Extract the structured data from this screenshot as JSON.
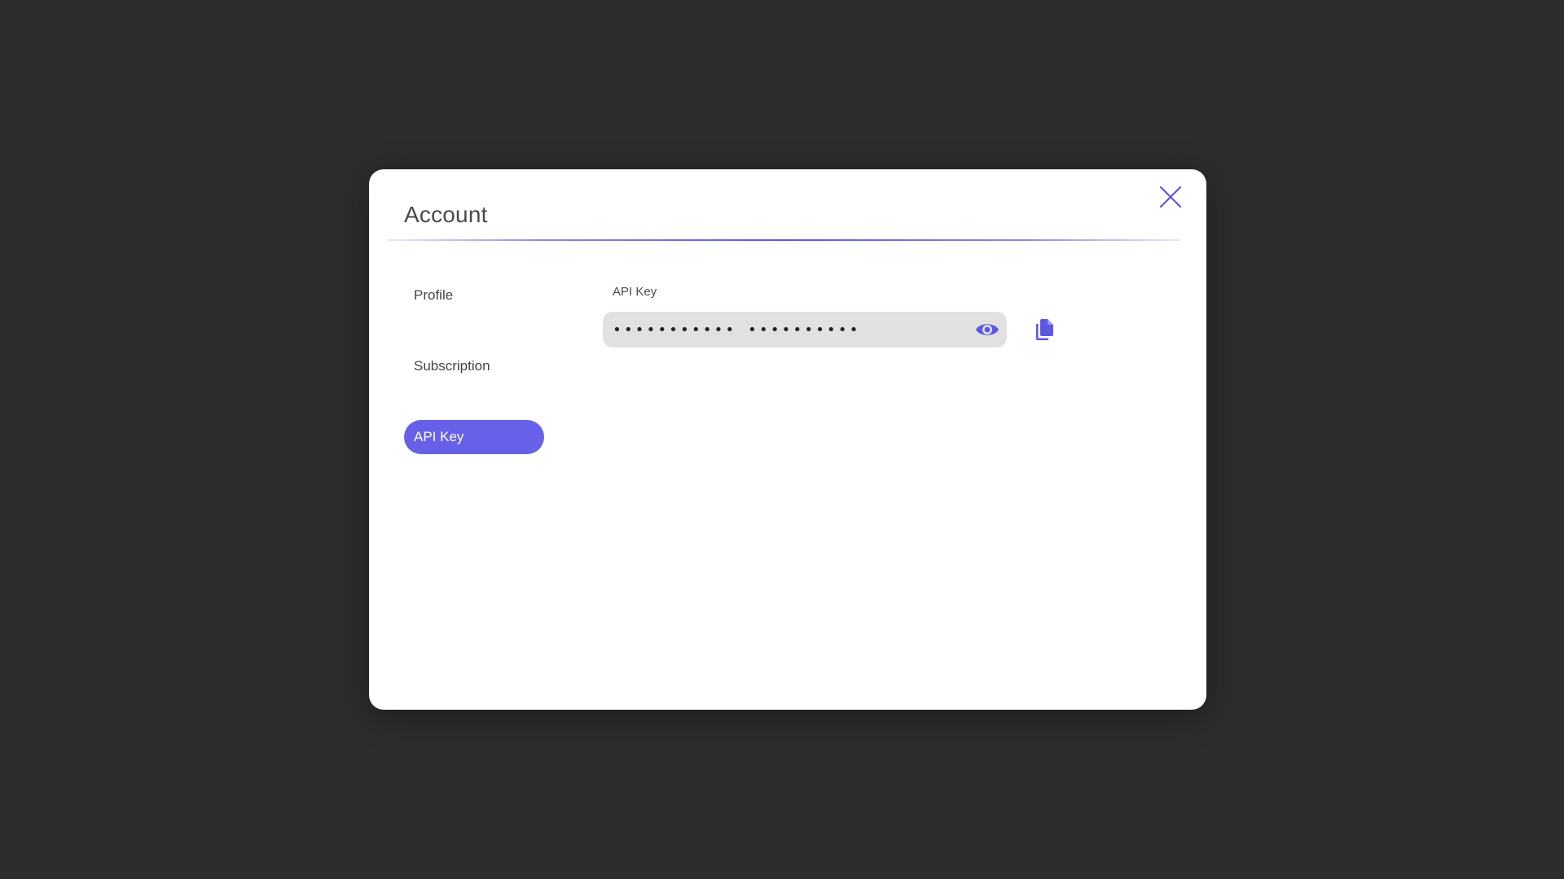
{
  "dialog": {
    "title": "Account",
    "close_icon": "close-icon"
  },
  "nav": {
    "items": [
      {
        "label": "Profile",
        "active": false
      },
      {
        "label": "Subscription",
        "active": false
      },
      {
        "label": "API Key",
        "active": true
      }
    ]
  },
  "api_key": {
    "label": "API Key",
    "masked_value": "•••••••••••  ••••••••••",
    "reveal_icon": "eye-icon",
    "copy_icon": "copy-icon"
  },
  "colors": {
    "accent": "#6661e8",
    "background": "#2d2d2d",
    "field_background": "#e1e1e1"
  }
}
